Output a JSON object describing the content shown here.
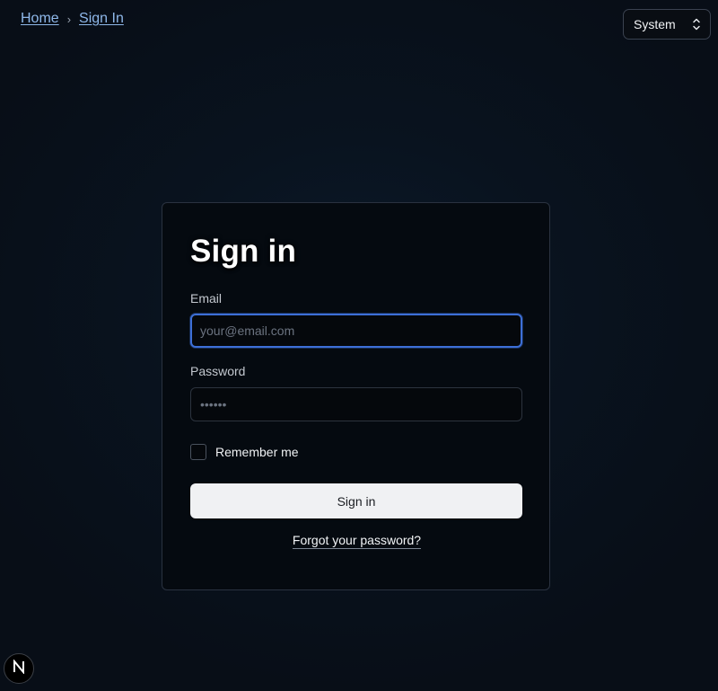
{
  "breadcrumb": {
    "items": [
      "Home",
      "Sign In"
    ],
    "separator": "›"
  },
  "theme": {
    "selected": "System",
    "icon": "chevron-up-down-icon"
  },
  "form": {
    "title": "Sign in",
    "email": {
      "label": "Email",
      "placeholder": "your@email.com",
      "value": ""
    },
    "password": {
      "label": "Password",
      "placeholder": "••••••",
      "value": ""
    },
    "remember": {
      "label": "Remember me",
      "checked": false
    },
    "submit_label": "Sign in",
    "forgot_label": "Forgot your password?"
  },
  "dev_badge": {
    "icon": "nextjs-logo-icon",
    "letter": "N"
  },
  "colors": {
    "background": "#080e17",
    "card": "#050a10",
    "link": "#8fb8ea",
    "focus_ring": "#3d6fd6",
    "button": "#f0f1f3"
  }
}
